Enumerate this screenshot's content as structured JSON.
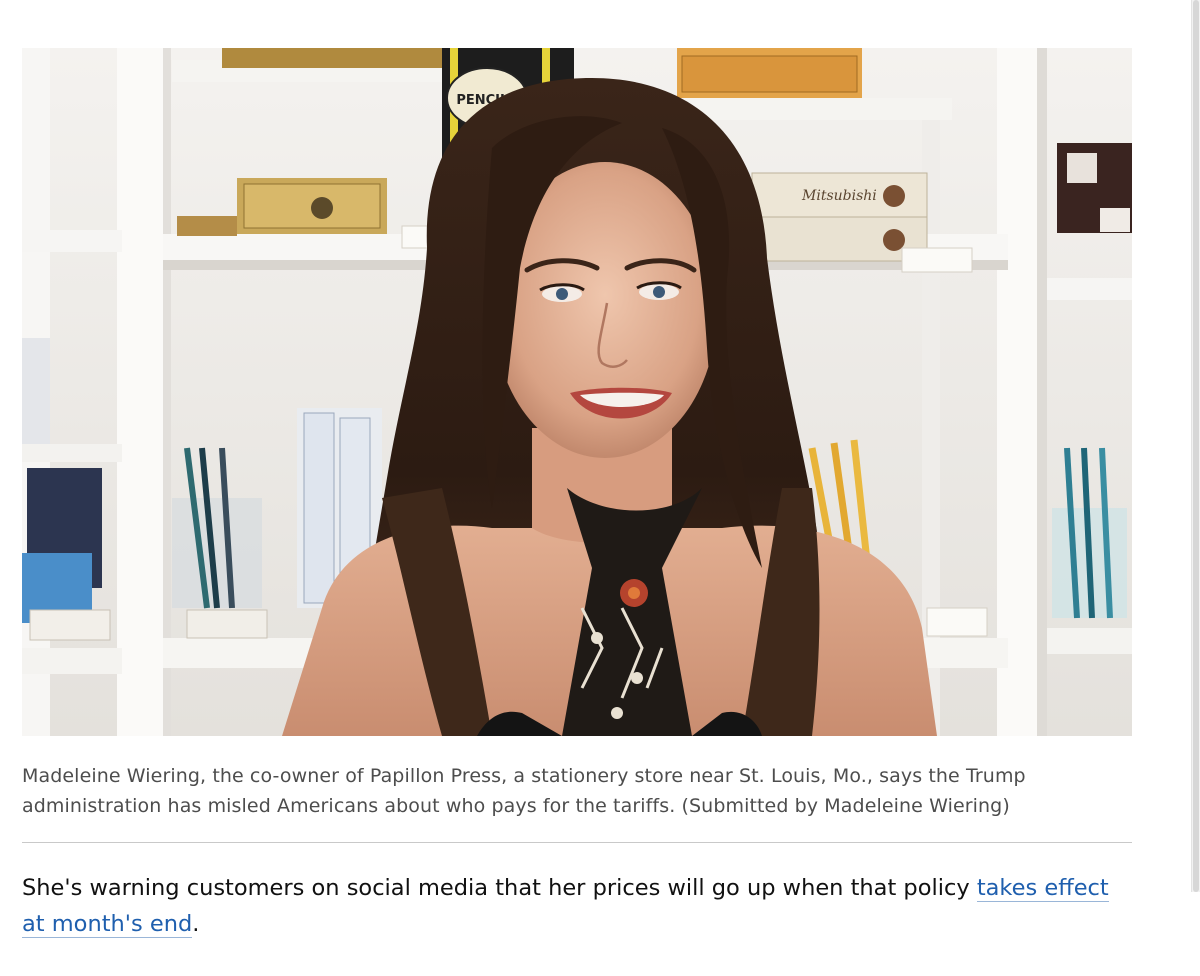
{
  "photo": {
    "alt_label": "Photo of Madeleine Wiering smiling in a stationery store",
    "shelf_label": "PENCILS",
    "box_label": "Mitsubishi"
  },
  "caption": {
    "text": "Madeleine Wiering, the co-owner of Papillon Press, a stationery store near St. Louis, Mo., says the Trump administration has misled Americans about who pays for the tariffs. (Submitted by Madeleine Wiering)"
  },
  "paragraph": {
    "before_link": "She's warning customers on social media that her prices will go up when that policy ",
    "link_text": "takes effect at month's end",
    "after_link": "."
  },
  "colors": {
    "link": "#1f5fae",
    "caption": "#4d4d4d",
    "body": "#111111"
  }
}
